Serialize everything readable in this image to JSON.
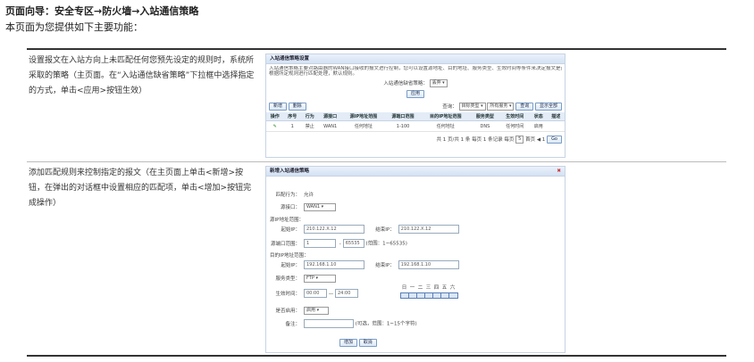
{
  "page": {
    "title": "页面向导：安全专区→防火墙→入站通信策略",
    "intro": "本页面为您提供如下主要功能："
  },
  "rows": [
    {
      "description": "设置报文在入站方向上未匹配任何您预先设定的规则时，系统所采取的策略（主页面。在“入站通信缺省策略”下拉框中选择指定的方式，单击<应用>按钮生效）"
    },
    {
      "description": "添加匹配规则来控制指定的报文（在主页面上单击<新增>按钮，在弹出的对话框中设置相应的匹配项，单击<增加>按钮完成操作）"
    }
  ],
  "main_shot": {
    "header": "入站通信策略设置",
    "note_line1": "入站通信策略主要对路由器的WAN接口接收的报文进行控制，您可以设置源地址、目的地址、服务类型、生效时间等条件来决定报文是否被允许通过",
    "note_line2": "根据所定规则进行匹配处理，默认规则。",
    "default_label": "入站通信缺省策略：",
    "default_value": "丢弃 ▾",
    "apply": "应用",
    "add": "新增",
    "delete": "删除",
    "query_label": "查询：",
    "query_field": "目标类型 ▾",
    "query_scope": "所有服务 ▾",
    "query_btn": "查询",
    "show_all": "显示全部",
    "columns": [
      "操作",
      "序号",
      "行为",
      "源接口",
      "源IP地址范围",
      "源端口范围",
      "目的IP地址范围",
      "服务类型",
      "生效时间",
      "状态",
      "描述"
    ],
    "row": [
      "✎",
      "1",
      "禁止",
      "WAN1",
      "任何地址",
      "1-100",
      "任何地址",
      "DNS",
      "任何时间",
      "启用",
      ""
    ],
    "pager": "共 1 页/共 1 条 每页 1 条记录 每页",
    "page_select": "5",
    "page_nav": "首页 ◀ 1",
    "go": "Go"
  },
  "dialog": {
    "header": "新增入站通信策略",
    "close": "✖",
    "action_label": "匹配行为：",
    "action_value": "允许",
    "src_if_label": "源接口：",
    "src_if_value": "WAN1 ▾",
    "src_ip_section": "源IP地址范围：",
    "start_ip_label": "起始IP：",
    "src_start": "210.122.X.12",
    "end_ip_label": "结束IP：",
    "src_end": "210.122.X.12",
    "src_port_label": "源端口范围：",
    "port_start": "1",
    "port_end": "65535",
    "port_hint": "(范围：1~65535)",
    "dst_ip_section": "目的IP地址范围：",
    "dst_start": "192.168.1.10",
    "dst_end": "192.168.1.10",
    "service_label": "服务类型：",
    "service_value": "FTP ▾",
    "time_label": "生效时间：",
    "time_start": "00:00",
    "time_sep": "—",
    "time_end": "24:00",
    "weekdays": [
      "日",
      "一",
      "二",
      "三",
      "四",
      "五",
      "六"
    ],
    "enable_label": "是否启用：",
    "enable_value": "启用 ▾",
    "remark_label": "备注：",
    "remark_hint": "(可选，范围：1~15个字符)",
    "add_btn": "增加",
    "cancel_btn": "取消"
  }
}
